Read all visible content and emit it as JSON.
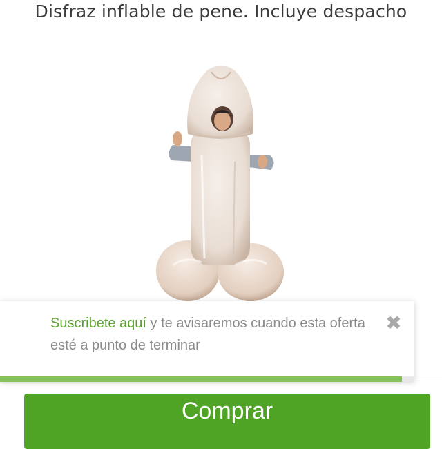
{
  "product": {
    "title": "Disfraz inflable de pene. Incluye despacho",
    "image_icon": "inflatable-costume-photo"
  },
  "subscribe_toast": {
    "link_text": "Suscribete aquí",
    "message": " y te avisaremos cuando esta oferta esté a punto de terminar",
    "close_glyph": "✖",
    "close_icon": "close-icon",
    "progress_fraction": 0.97,
    "progress_color": "#83c35a",
    "link_color": "#5aa22b"
  },
  "buy_button": {
    "label": "Comprar",
    "color": "#4fa425"
  }
}
